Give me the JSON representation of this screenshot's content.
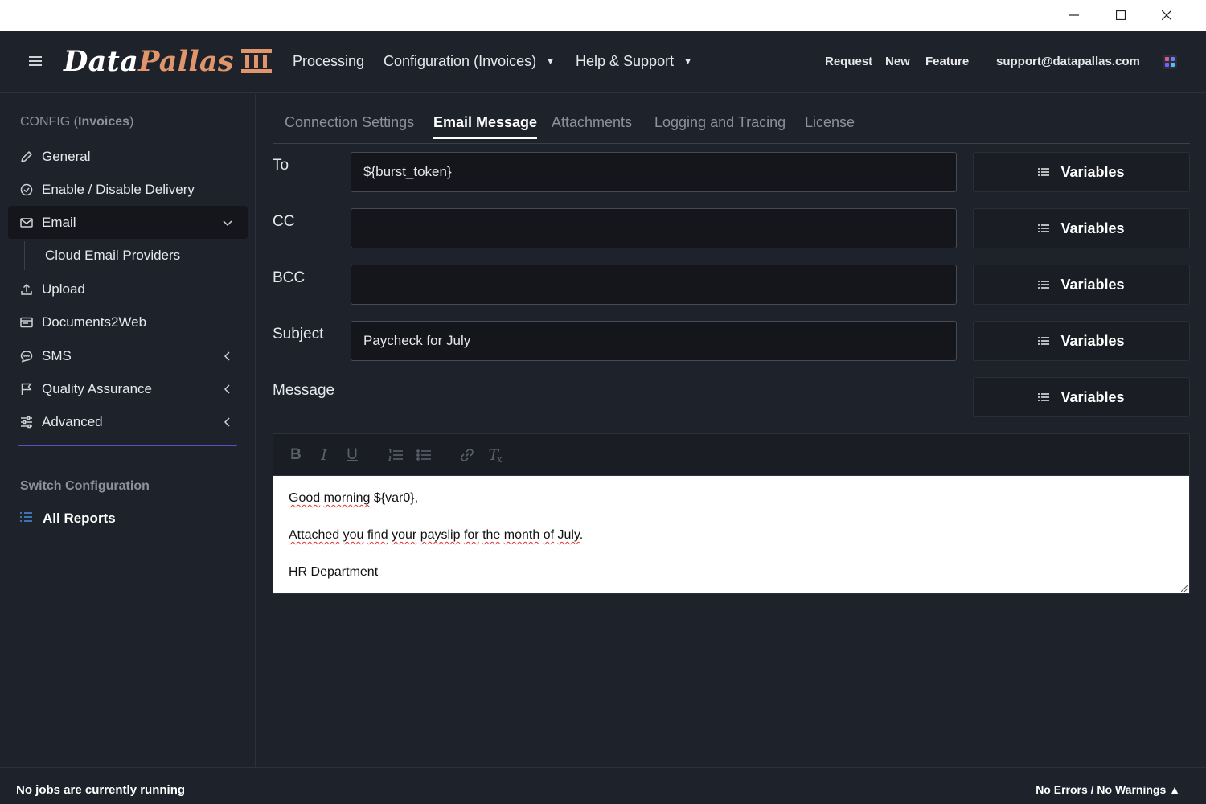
{
  "window": {
    "minimize_icon": "minimize-icon",
    "maximize_icon": "maximize-icon",
    "close_icon": "close-icon"
  },
  "header": {
    "logo_part1": "Data",
    "logo_part2": "Pallas",
    "nav": {
      "processing": "Processing",
      "configuration": "Configuration (Invoices)",
      "help": "Help & Support"
    },
    "request_label": "Request",
    "new_label": "New",
    "feature_label": "Feature",
    "support_email": "support@datapallas.com",
    "colors": {
      "logo_accent": "#e0956a",
      "background": "#1e222b"
    }
  },
  "sidebar": {
    "config_prefix": "CONFIG (",
    "config_name": "Invoices",
    "config_suffix": ")",
    "items": {
      "general": "General",
      "delivery": "Enable / Disable Delivery",
      "email": "Email",
      "cloud": "Cloud Email Providers",
      "upload": "Upload",
      "docs2web": "Documents2Web",
      "sms": "SMS",
      "qa": "Quality Assurance",
      "advanced": "Advanced"
    },
    "switch_heading": "Switch Configuration",
    "all_reports": "All Reports"
  },
  "tabs": {
    "connection": "Connection Settings",
    "email_message": "Email Message",
    "attachments": "Attachments",
    "logging": "Logging and Tracing",
    "license": "License"
  },
  "form": {
    "to_label": "To",
    "to_value": "${burst_token}",
    "cc_label": "CC",
    "cc_value": "",
    "bcc_label": "BCC",
    "bcc_value": "",
    "subject_label": "Subject",
    "subject_value": "Paycheck for July",
    "message_label": "Message",
    "variables_label": "Variables"
  },
  "editor": {
    "line1_a": "Good",
    "line1_b": "morning",
    "line1_c": " ${var0},",
    "line2_a": "Attached",
    "line2_b": "you",
    "line2_c": "find",
    "line2_d": "your",
    "line2_e": "payslip",
    "line2_f": "for",
    "line2_g": "the",
    "line2_h": "month",
    "line2_i": "of",
    "line2_j": "July",
    "line2_k": ".",
    "line3": "HR Department"
  },
  "status": {
    "jobs": "No jobs are currently running",
    "errors": "No Errors / No Warnings ▲"
  }
}
